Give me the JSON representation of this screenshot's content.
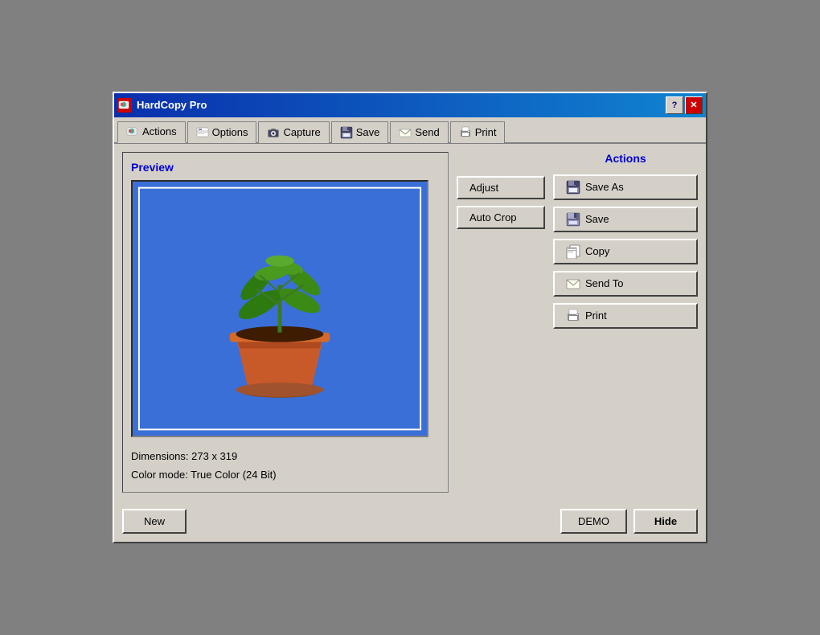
{
  "window": {
    "title": "HardCopy Pro",
    "icon": "📋"
  },
  "titlebar": {
    "help_label": "?",
    "close_label": "✕"
  },
  "tabs": [
    {
      "id": "actions",
      "label": "Actions",
      "icon": "🔧",
      "active": true
    },
    {
      "id": "options",
      "label": "Options",
      "icon": "📋"
    },
    {
      "id": "capture",
      "label": "Capture",
      "icon": "📷"
    },
    {
      "id": "save",
      "label": "Save",
      "icon": "💾"
    },
    {
      "id": "send",
      "label": "Send",
      "icon": "✉️"
    },
    {
      "id": "print",
      "label": "Print",
      "icon": "🖨️"
    }
  ],
  "preview": {
    "title": "Preview",
    "dimensions": "Dimensions: 273 x 319",
    "color_mode": "Color mode: True Color (24 Bit)"
  },
  "middle_buttons": {
    "adjust_label": "Adjust",
    "autocrop_label": "Auto Crop"
  },
  "actions": {
    "title": "Actions",
    "buttons": [
      {
        "id": "save-as",
        "label": "Save As",
        "icon": "💾"
      },
      {
        "id": "save",
        "label": "Save",
        "icon": "📄"
      },
      {
        "id": "copy",
        "label": "Copy",
        "icon": "📋"
      },
      {
        "id": "send-to",
        "label": "Send To",
        "icon": "✉️"
      },
      {
        "id": "print",
        "label": "Print",
        "icon": "🖨️"
      }
    ]
  },
  "footer": {
    "new_label": "New",
    "demo_label": "DEMO",
    "hide_label": "Hide"
  }
}
